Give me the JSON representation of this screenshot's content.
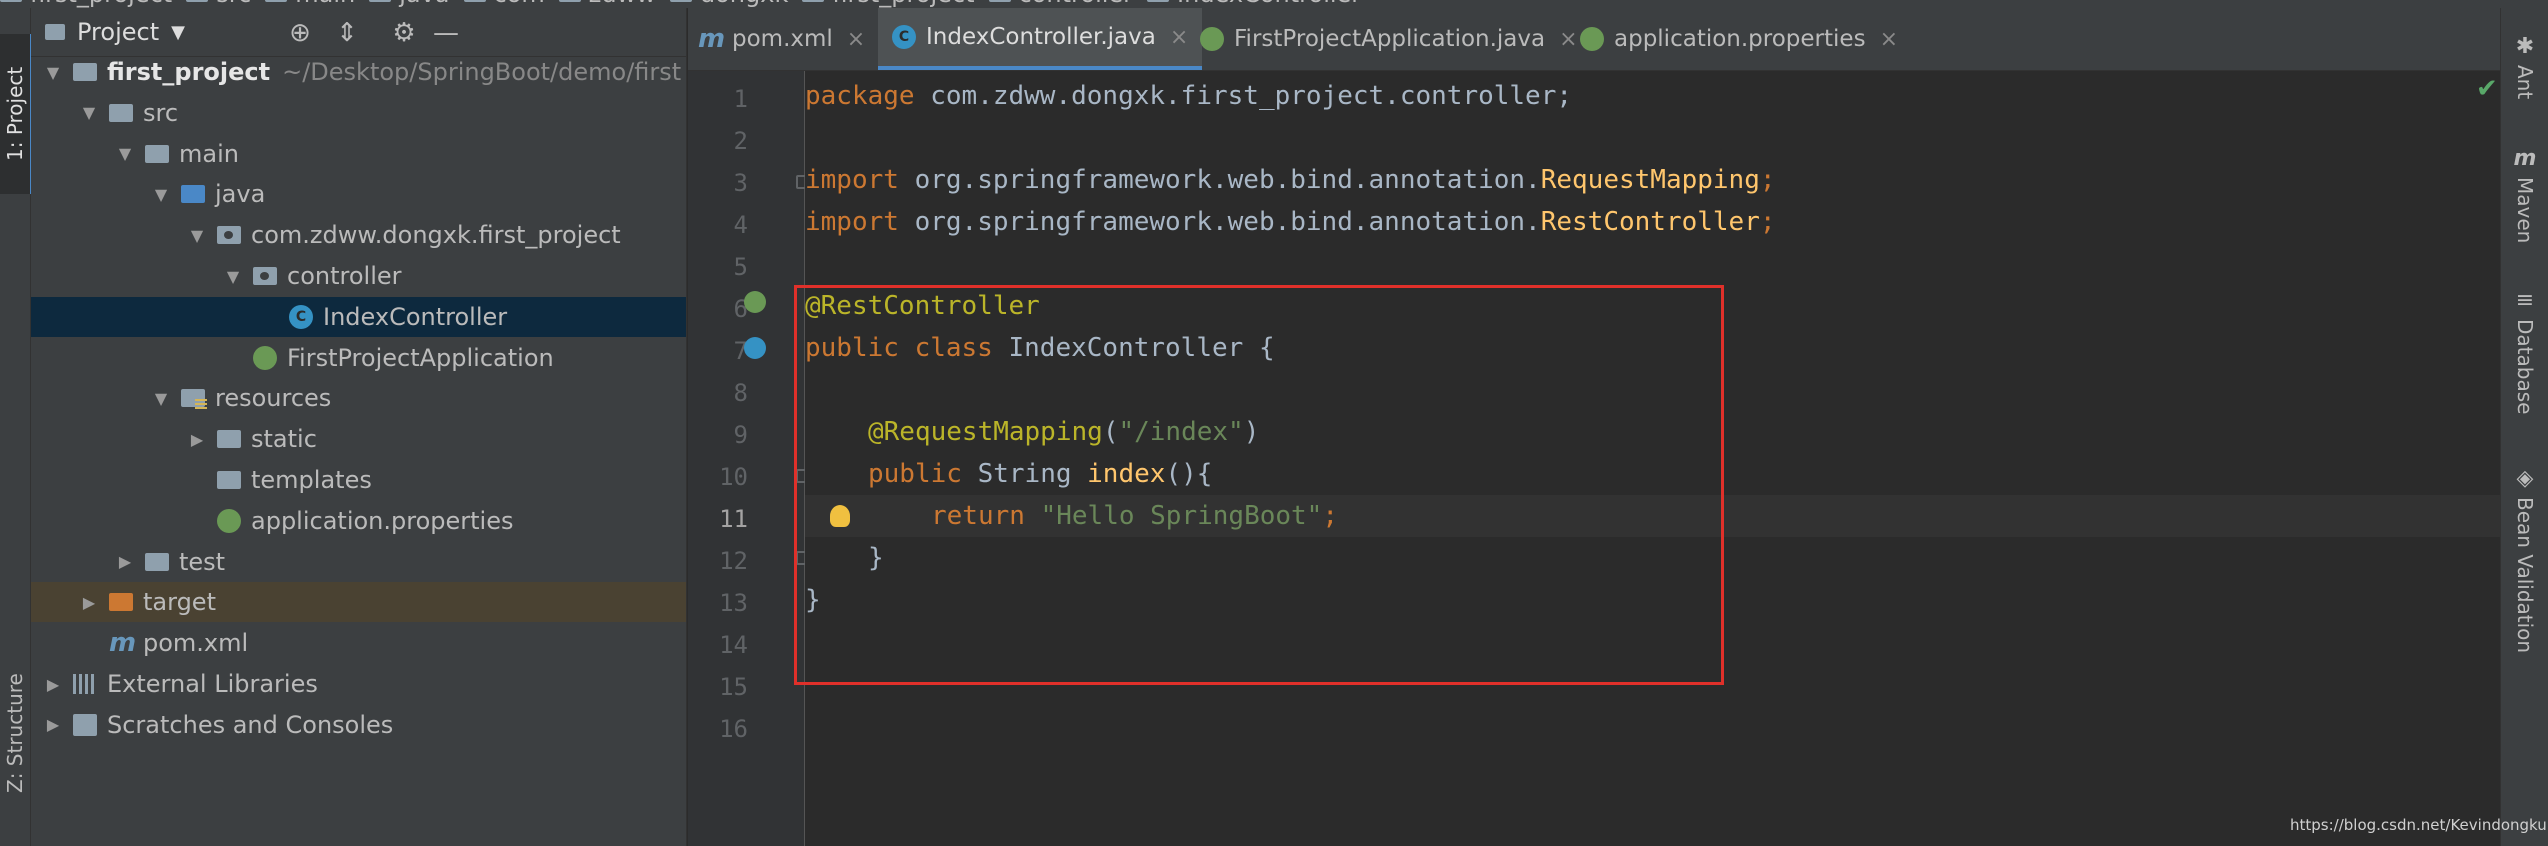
{
  "breadcrumbs": [
    "first_project",
    "src",
    "main",
    "java",
    "com",
    "zdww",
    "dongxk",
    "first_project",
    "controller",
    "IndexController"
  ],
  "left_strip": {
    "project_tab": "1: Project",
    "structure_tab": "Z: Structure"
  },
  "project_panel": {
    "title": "Project"
  },
  "tree": [
    {
      "label": "first_project",
      "path": "~/Desktop/SpringBoot/demo/first",
      "icon": "folder-icon",
      "arrow": "▼",
      "indent": 0
    },
    {
      "label": "src",
      "icon": "folder-icon",
      "arrow": "▼",
      "indent": 1
    },
    {
      "label": "main",
      "icon": "folder-icon",
      "arrow": "▼",
      "indent": 2
    },
    {
      "label": "java",
      "icon": "source-folder-icon",
      "arrow": "▼",
      "indent": 3
    },
    {
      "label": "com.zdww.dongxk.first_project",
      "icon": "package-icon",
      "arrow": "▼",
      "indent": 4
    },
    {
      "label": "controller",
      "icon": "package-icon",
      "arrow": "▼",
      "indent": 5
    },
    {
      "label": "IndexController",
      "icon": "class-icon",
      "arrow": "",
      "indent": 6
    },
    {
      "label": "FirstProjectApplication",
      "icon": "spring-boot-icon",
      "arrow": "",
      "indent": 5
    },
    {
      "label": "resources",
      "icon": "resources-folder-icon",
      "arrow": "▼",
      "indent": 3
    },
    {
      "label": "static",
      "icon": "folder-icon",
      "arrow": "▶",
      "indent": 4
    },
    {
      "label": "templates",
      "icon": "folder-icon",
      "arrow": "",
      "indent": 4
    },
    {
      "label": "application.properties",
      "icon": "spring-properties-icon",
      "arrow": "",
      "indent": 4
    },
    {
      "label": "test",
      "icon": "folder-icon",
      "arrow": "▶",
      "indent": 2
    },
    {
      "label": "target",
      "icon": "excluded-folder-icon",
      "arrow": "▶",
      "indent": 1
    },
    {
      "label": "pom.xml",
      "icon": "maven-icon",
      "arrow": "",
      "indent": 1
    },
    {
      "label": "External Libraries",
      "icon": "library-icon",
      "arrow": "▶",
      "indent": 0
    },
    {
      "label": "Scratches and Consoles",
      "icon": "scratch-icon",
      "arrow": "▶",
      "indent": 0
    }
  ],
  "tabs": [
    {
      "label": "pom.xml",
      "icon_glyph": "m"
    },
    {
      "label": "IndexController.java",
      "icon_glyph": "C"
    },
    {
      "label": "FirstProjectApplication.java",
      "icon_glyph": ""
    },
    {
      "label": "application.properties",
      "icon_glyph": ""
    }
  ],
  "tab_close_glyph": "×",
  "line_numbers": [
    "1",
    "2",
    "3",
    "4",
    "5",
    "6",
    "7",
    "8",
    "9",
    "10",
    "11",
    "12",
    "13",
    "14",
    "15",
    "16"
  ],
  "code": {
    "l1_kw": "package",
    "l1_rest": " com.zdww.dongxk.first_project.controller;",
    "l3_kw": "import",
    "l3_pkg": " org.springframework.web.bind.annotation.",
    "l3_cls": "RequestMapping",
    "l3_end": ";",
    "l4_kw": "import",
    "l4_pkg": " org.springframework.web.bind.annotation.",
    "l4_cls": "RestController",
    "l4_end": ";",
    "l6_ann": "@RestController",
    "l7_kw": "public class",
    "l7_rest": " IndexController {",
    "l9_ann": "@RequestMapping",
    "l9_open": "(",
    "l9_str": "\"/index\"",
    "l9_close": ")",
    "l10_kw": "public",
    "l10_type": " String ",
    "l10_fn": "index",
    "l10_rest": "(){",
    "l11_kw": "return",
    "l11_str": " \"Hello SpringBoot\"",
    "l11_end": ";",
    "l12": "}",
    "l13": "}"
  },
  "right_strip": [
    "Ant",
    "Maven",
    "Database",
    "Bean Validation"
  ],
  "watermark": "https://blog.csdn.net/Kevindongkun",
  "colors": {
    "keyword": "#cc7832",
    "annotation": "#bbb529",
    "string": "#6a8759",
    "function": "#ffc66d",
    "text": "#a9b7c6",
    "highlight_box": "#e0302a",
    "selection": "#0d293e"
  }
}
